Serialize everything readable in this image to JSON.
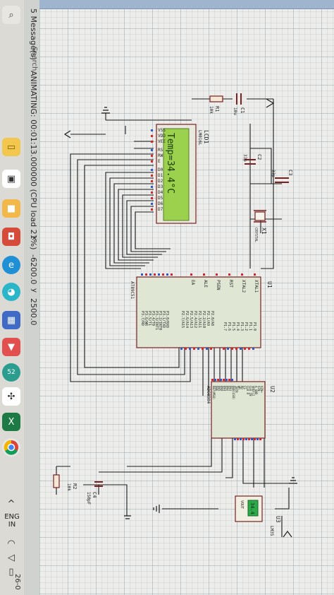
{
  "statusbar": {
    "messages": "5 Message(s)",
    "animation": "ANIMATING: 00:01:13.000000 (CPU load 21%)",
    "x_label": "x",
    "x_value": "-6200.0",
    "y_label": "y",
    "y_value": "2500.0",
    "search": "Search"
  },
  "taskbar": {
    "lang_top": "ENG",
    "lang_bottom": "IN",
    "date_fragment": "26-0",
    "badge_count": "52",
    "icons": [
      "file-explorer-icon",
      "store-icon",
      "office-icon",
      "edge-icon",
      "ms-teams-icon",
      "security-icon",
      "avatar-icon",
      "excel-icon",
      "chrome-icon",
      "chevron-up-icon",
      "wifi-icon",
      "speaker-icon",
      "battery-icon"
    ]
  },
  "schematic": {
    "lcd": {
      "ref": "LCD1",
      "model": "LM016L",
      "display_text": "Temp=34.4°C",
      "pins": [
        "VSS",
        "VDD",
        "VEE",
        "RS",
        "RW",
        "E",
        "D0",
        "D1",
        "D2",
        "D3",
        "D4",
        "D5",
        "D6",
        "D7"
      ]
    },
    "u1": {
      "ref": "U1",
      "model": "AT89C51",
      "left_pins": [
        "XTAL1",
        "XTAL2",
        "RST",
        "PSEN",
        "ALE",
        "EA"
      ],
      "p3_pins": [
        "P3.0/RXD",
        "P3.1/TXD",
        "P3.2/INT0",
        "P3.3/INT1",
        "P3.4/T0",
        "P3.5/T1",
        "P3.6/WR",
        "P3.7/RD"
      ],
      "p2_pins": [
        "P2.0/A8",
        "P2.1/A9",
        "P2.2/A10",
        "P2.3/A11",
        "P2.4/A12",
        "P2.5/A13",
        "P2.6/A14",
        "P2.7/A15"
      ],
      "p1_pins": [
        "P1.0",
        "P1.1",
        "P1.2",
        "P1.3",
        "P1.4",
        "P1.5",
        "P1.6",
        "P1.7"
      ]
    },
    "u2": {
      "ref": "U2",
      "model": "ADC0804",
      "pins": [
        "VIN+",
        "VIN-",
        "A GND",
        "VREF/2",
        "CLK IN",
        "CLK R",
        "CS",
        "RD",
        "WR",
        "INTR",
        "DB0(LSB)",
        "DB1",
        "DB2",
        "DB3",
        "DB4",
        "DB5",
        "DB6",
        "DB7(MSB)"
      ]
    },
    "u3": {
      "ref": "U3",
      "model": "LM35",
      "reading": "34.4",
      "pin_vout": "VOUT"
    },
    "r1": {
      "ref": "R1",
      "value": "10k"
    },
    "r2": {
      "ref": "R2",
      "value": "10k"
    },
    "c1": {
      "ref": "C1",
      "value": "10u"
    },
    "c2": {
      "ref": "C2",
      "value": "33p"
    },
    "c3": {
      "ref": "C3",
      "value": "33p"
    },
    "c4": {
      "ref": "C4",
      "value": "150pF"
    },
    "x1": {
      "ref": "X1",
      "value": "CRYSTAL"
    },
    "pin_numbers": [
      "19",
      "18",
      "9",
      "29",
      "30",
      "31",
      "1",
      "2",
      "3",
      "4",
      "5",
      "6",
      "7",
      "8",
      "21",
      "22",
      "23",
      "24",
      "25",
      "26",
      "27",
      "28",
      "10",
      "11",
      "12",
      "13",
      "14",
      "15",
      "16",
      "17"
    ]
  },
  "colors": {
    "wire": "#1a1a1a",
    "component": "#7a2020",
    "chip_fill": "#dfe7d4",
    "lcd_fill": "#9bd14d",
    "pin_red": "#d8232a",
    "pin_blue": "#2f56c9"
  }
}
